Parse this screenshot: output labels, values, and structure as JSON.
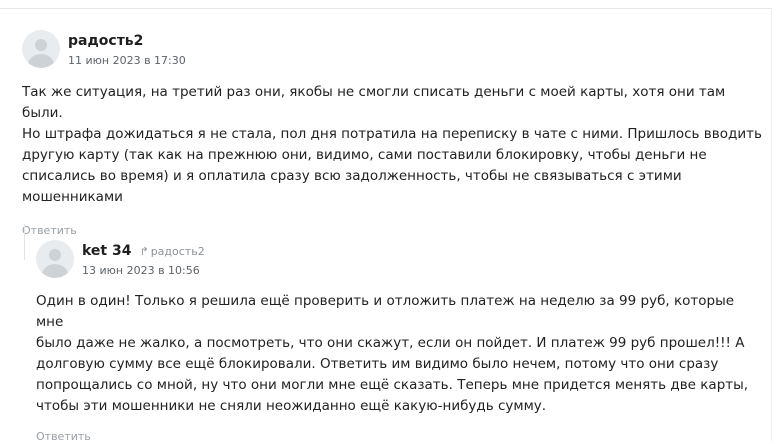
{
  "comments": [
    {
      "author": "радость2",
      "date": "11 июн 2023 в 17:30",
      "lines": [
        "Так же ситуация, на третий раз они, якобы не смогли списать деньги с моей карты, хотя они там были.",
        "Но штрафа дожидаться я не стала, пол дня потратила на переписку в чате с ними. Пришлось вводить",
        "другую карту (так как на прежнюю они, видимо, сами поставили блокировку, чтобы деньги не",
        "списались во время) и я оплатила сразу всю задолженность, чтобы не связываться с этими",
        "мошенниками"
      ],
      "reply_label": "Ответить"
    },
    {
      "author": "ket 34",
      "reply_to": "радость2",
      "date": "13 июн 2023 в 10:56",
      "lines": [
        "Один в один! Только я решила ещё проверить и отложить платеж на неделю за 99 руб, которые мне",
        "было даже не жалко, а посмотреть, что они скажут, если он пойдет. И платеж 99 руб прошел!!! А",
        "долговую сумму все ещё блокировали. Ответить им видимо было нечем, потому что они сразу",
        "попрощались со мной, ну что они могли мне ещё сказать. Теперь мне придется менять две карты,",
        "чтобы эти мошенники не сняли неожиданно ещё какую-нибудь сумму."
      ],
      "reply_label": "Ответить"
    }
  ],
  "icons": {
    "avatar": "default-user-avatar",
    "reply_to": "reply-arrow-icon"
  },
  "colors": {
    "text": "#222222",
    "muted": "#9aa0a6",
    "date": "#5e6368",
    "avatar_bg": "#e9ecef"
  }
}
